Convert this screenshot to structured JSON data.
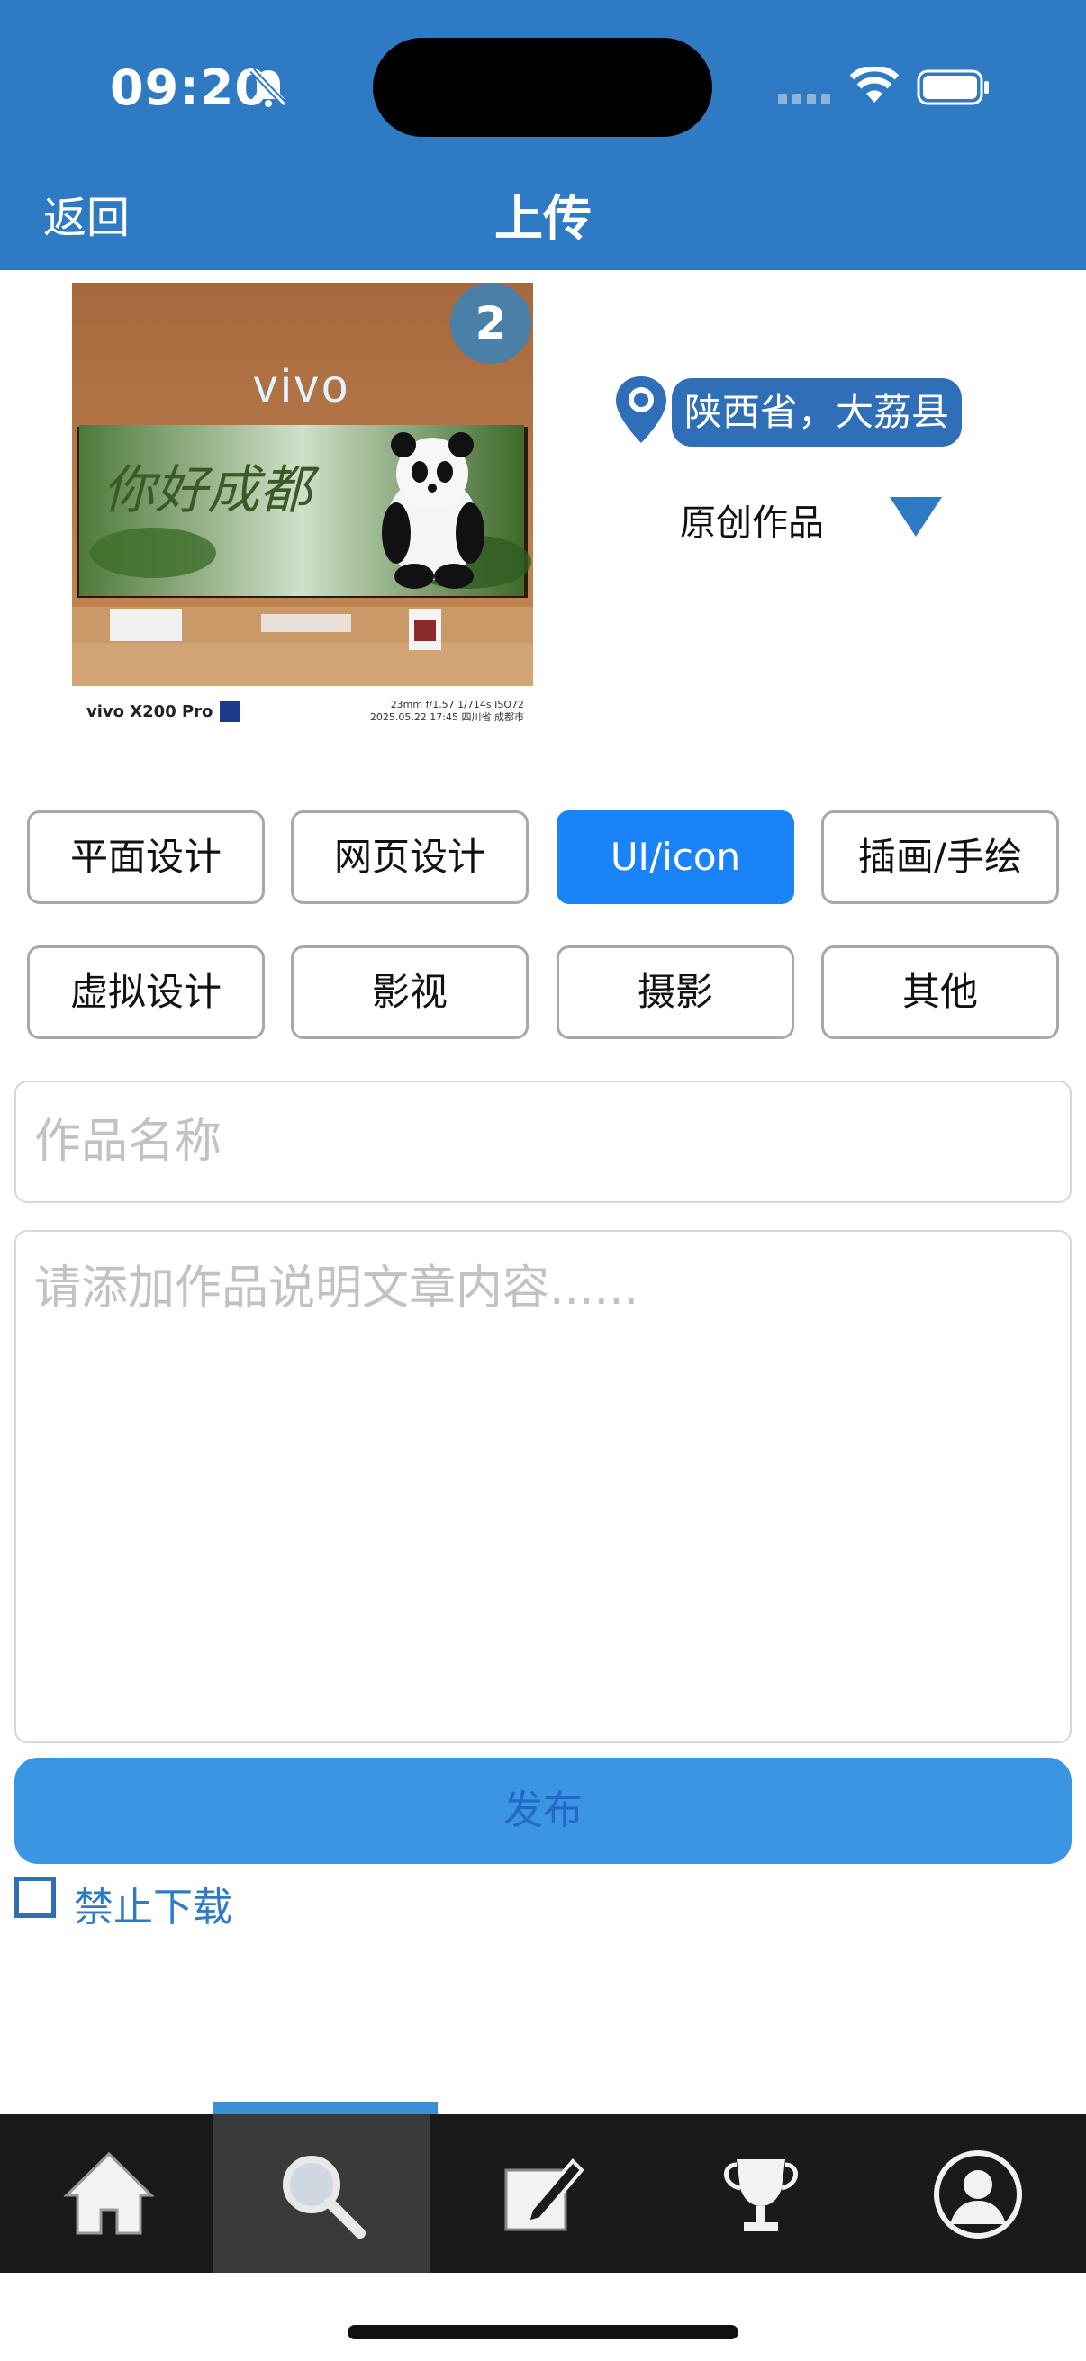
{
  "status_bar": {
    "time": "09:20"
  },
  "header": {
    "back_label": "返回",
    "title": "上传"
  },
  "photo": {
    "count": "2",
    "brand_text": "vivo",
    "scene_text": "你好成都",
    "caption_left": "vivo X200 Pro",
    "caption_right_line1": "23mm  f/1.57  1/714s  ISO72",
    "caption_right_line2": "2025.05.22 17:45  四川省 成都市"
  },
  "location": {
    "text": "陕西省，大荔县"
  },
  "original": {
    "label": "原创作品"
  },
  "categories": [
    {
      "label": "平面设计",
      "selected": false
    },
    {
      "label": "网页设计",
      "selected": false
    },
    {
      "label": "UI/icon",
      "selected": true
    },
    {
      "label": "插画/手绘",
      "selected": false
    },
    {
      "label": "虚拟设计",
      "selected": false
    },
    {
      "label": "影视",
      "selected": false
    },
    {
      "label": "摄影",
      "selected": false
    },
    {
      "label": "其他",
      "selected": false
    }
  ],
  "form": {
    "name_placeholder": "作品名称",
    "name_value": "",
    "description_placeholder": "请添加作品说明文章内容......",
    "description_value": "",
    "publish_label": "发布",
    "no_download_label": "禁止下载",
    "no_download_checked": false
  },
  "tabbar": {
    "active": "search",
    "tabs": [
      {
        "icon": "home-icon"
      },
      {
        "icon": "search-icon"
      },
      {
        "icon": "edit-icon"
      },
      {
        "icon": "trophy-icon"
      },
      {
        "icon": "profile-icon"
      }
    ]
  },
  "colors": {
    "header_bg": "#2e7bc4",
    "selected_category": "#1a83f7",
    "publish_button": "#3a96e2",
    "tabbar_bg": "#1a1a1a"
  }
}
